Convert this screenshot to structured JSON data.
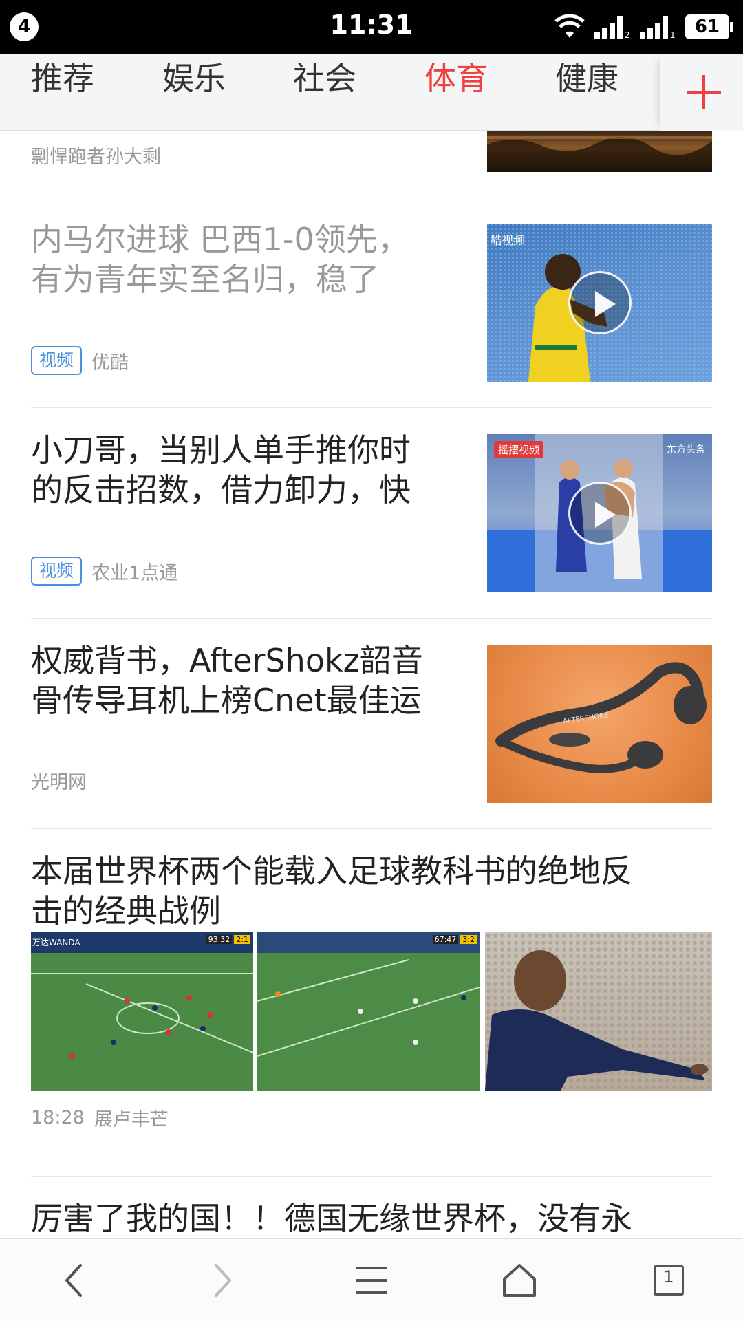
{
  "status_bar": {
    "notification_count": "4",
    "time": "11:31",
    "battery": "61",
    "icons": [
      "wifi-icon",
      "signal-sim2-icon",
      "signal-sim1-icon",
      "battery-icon"
    ]
  },
  "tabs": [
    {
      "label": "推荐",
      "active": false
    },
    {
      "label": "娱乐",
      "active": false
    },
    {
      "label": "社会",
      "active": false
    },
    {
      "label": "体育",
      "active": true
    },
    {
      "label": "健康",
      "active": false
    }
  ],
  "colors": {
    "accent": "#f04142",
    "tag_blue": "#4a90e2",
    "meta_gray": "#999999"
  },
  "articles": [
    {
      "title": "",
      "source": "剽悍跑者孙大剩",
      "tag": ""
    },
    {
      "title_lines": [
        "内马尔进球 巴西1-0领先，",
        "有为青年实至名归，稳了"
      ],
      "tag": "视频",
      "source": "优酷",
      "read": true,
      "thumb_label": "酷视频"
    },
    {
      "title_lines": [
        "小刀哥，当别人单手推你时",
        "的反击招数，借力卸力，快"
      ],
      "tag": "视频",
      "source": "农业1点通",
      "thumb_label_left": "摇摆视频",
      "thumb_label_right": "东方头条"
    },
    {
      "title_lines": [
        "权威背书，AfterShokz韶音",
        "骨传导耳机上榜Cnet最佳运"
      ],
      "source": "光明网",
      "product_text": "AFTERSHOKZ"
    },
    {
      "title_lines": [
        "本届世界杯两个能载入足球教科书的绝地反",
        "击的经典战例"
      ],
      "time": "18:28",
      "source": "展卢丰芒",
      "thumb1_score": "2:1",
      "thumb1_clock": "93:32",
      "thumb1_sponsor": "万达WANDA",
      "thumb2_score": "3:2",
      "thumb2_clock": "67:47"
    },
    {
      "title_lines": [
        "厉害了我的国！！德国无缘世界杯，没有永"
      ]
    }
  ],
  "bottom_nav": {
    "tab_count": "1",
    "icons": [
      "back-icon",
      "forward-icon",
      "menu-icon",
      "home-icon",
      "tabs-icon"
    ]
  }
}
